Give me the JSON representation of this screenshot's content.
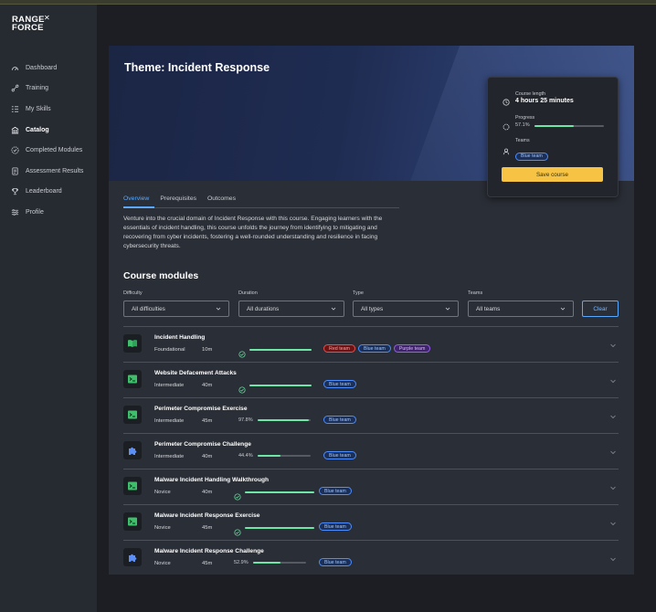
{
  "brand": {
    "line1": "RANGE",
    "line2": "FORCE"
  },
  "sidebar": {
    "items": [
      {
        "label": "Dashboard",
        "icon": "dashboard-icon",
        "active": false
      },
      {
        "label": "Training",
        "icon": "training-icon",
        "active": false
      },
      {
        "label": "My Skills",
        "icon": "skills-icon",
        "active": false
      },
      {
        "label": "Catalog",
        "icon": "catalog-icon",
        "active": true
      },
      {
        "label": "Completed Modules",
        "icon": "completed-icon",
        "active": false
      },
      {
        "label": "Assessment Results",
        "icon": "assessment-icon",
        "active": false
      },
      {
        "label": "Leaderboard",
        "icon": "trophy-icon",
        "active": false
      },
      {
        "label": "Profile",
        "icon": "profile-icon",
        "active": false
      }
    ]
  },
  "hero": {
    "title": "Theme: Incident Response"
  },
  "course_card": {
    "length_label": "Course length",
    "length_value": "4 hours 25 minutes",
    "progress_label": "Progress",
    "progress_text": "57.1%",
    "progress_value": 0.571,
    "teams_label": "Teams",
    "team": "Blue team",
    "save_label": "Save course"
  },
  "tabs": [
    {
      "label": "Overview",
      "active": true
    },
    {
      "label": "Prerequisites",
      "active": false
    },
    {
      "label": "Outcomes",
      "active": false
    }
  ],
  "description": "Venture into the crucial domain of Incident Response with this course. Engaging learners with the essentials of incident handling, this course unfolds the journey from identifying to mitigating and recovering from cyber incidents, fostering a well-rounded understanding and resilience in facing cybersecurity threats.",
  "modules_title": "Course modules",
  "filters": [
    {
      "label": "Difficulty",
      "value": "All difficulties"
    },
    {
      "label": "Duration",
      "value": "All durations"
    },
    {
      "label": "Type",
      "value": "All types"
    },
    {
      "label": "Teams",
      "value": "All teams"
    }
  ],
  "clear_label": "Clear",
  "modules": [
    {
      "title": "Incident Handling",
      "difficulty": "Foundational",
      "duration": "10m",
      "icon": "book-icon",
      "completed": true,
      "progress_text": "",
      "progress_value": 1.0,
      "teams": [
        "Red team",
        "Blue team",
        "Purple team"
      ]
    },
    {
      "title": "Website Defacement Attacks",
      "difficulty": "Intermediate",
      "duration": "40m",
      "icon": "terminal-icon",
      "completed": true,
      "progress_text": "",
      "progress_value": 1.0,
      "teams": [
        "Blue team"
      ]
    },
    {
      "title": "Perimeter Compromise Exercise",
      "difficulty": "Intermediate",
      "duration": "45m",
      "icon": "terminal-icon",
      "completed": false,
      "progress_text": "97.8%",
      "progress_value": 0.978,
      "teams": [
        "Blue team"
      ]
    },
    {
      "title": "Perimeter Compromise Challenge",
      "difficulty": "Intermediate",
      "duration": "40m",
      "icon": "puzzle-icon",
      "completed": false,
      "progress_text": "44.4%",
      "progress_value": 0.444,
      "teams": [
        "Blue team"
      ]
    },
    {
      "title": "Malware Incident Handling Walkthrough",
      "difficulty": "Novice",
      "duration": "40m",
      "icon": "terminal-icon",
      "completed": true,
      "progress_text": "",
      "progress_value": 1.0,
      "teams": [
        "Blue team"
      ]
    },
    {
      "title": "Malware Incident Response Exercise",
      "difficulty": "Novice",
      "duration": "45m",
      "icon": "terminal-icon",
      "completed": true,
      "progress_text": "",
      "progress_value": 1.0,
      "teams": [
        "Blue team"
      ]
    },
    {
      "title": "Malware Incident Response Challenge",
      "difficulty": "Novice",
      "duration": "45m",
      "icon": "puzzle-icon",
      "completed": false,
      "progress_text": "52.9%",
      "progress_value": 0.529,
      "teams": [
        "Blue team"
      ]
    }
  ],
  "colors": {
    "accent": "#5aa9ff",
    "progress": "#6ee7a6",
    "save": "#f6c344"
  }
}
